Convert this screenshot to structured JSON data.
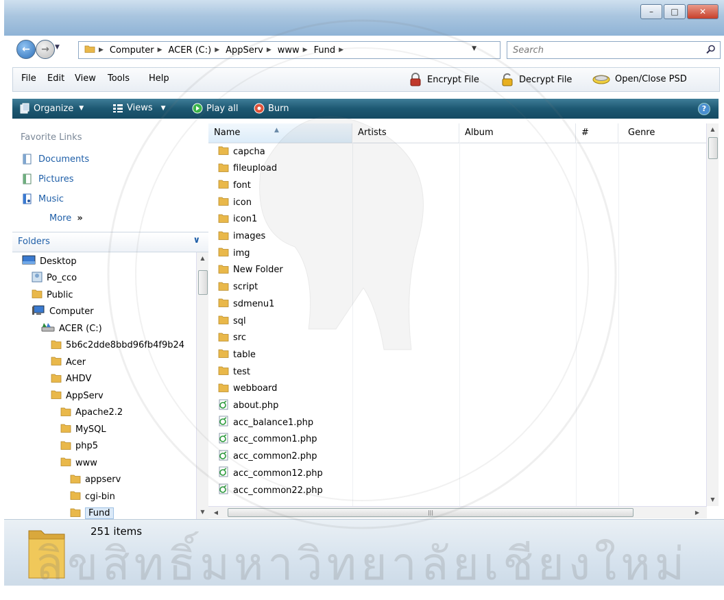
{
  "address": {
    "segments": [
      "Computer",
      "ACER (C:)",
      "AppServ",
      "www",
      "Fund"
    ]
  },
  "search": {
    "placeholder": "Search"
  },
  "menubar": {
    "items": [
      "File",
      "Edit",
      "View",
      "Tools",
      "Help"
    ],
    "tools": [
      "Encrypt File",
      "Decrypt File",
      "Open/Close PSD"
    ]
  },
  "commandbar": {
    "organize": "Organize",
    "views": "Views",
    "play_all": "Play all",
    "burn": "Burn"
  },
  "favorites": {
    "title": "Favorite Links",
    "items": [
      "Documents",
      "Pictures",
      "Music"
    ],
    "more": "More",
    "more_glyph": "»"
  },
  "folders": {
    "title": "Folders",
    "tree": [
      {
        "label": "Desktop",
        "icon": "desktop-icon"
      },
      {
        "label": "Po_cco",
        "icon": "user-icon"
      },
      {
        "label": "Public",
        "icon": "folder-icon"
      },
      {
        "label": "Computer",
        "icon": "computer-icon"
      },
      {
        "label": "ACER (C:)",
        "icon": "drive-icon"
      },
      {
        "label": "5b6c2dde8bbd96fb4f9b24",
        "icon": "folder-icon"
      },
      {
        "label": "Acer",
        "icon": "folder-icon"
      },
      {
        "label": "AHDV",
        "icon": "folder-icon"
      },
      {
        "label": "AppServ",
        "icon": "folder-icon"
      },
      {
        "label": "Apache2.2",
        "icon": "folder-icon"
      },
      {
        "label": "MySQL",
        "icon": "folder-icon"
      },
      {
        "label": "php5",
        "icon": "folder-icon"
      },
      {
        "label": "www",
        "icon": "folder-icon"
      },
      {
        "label": "appserv",
        "icon": "folder-icon"
      },
      {
        "label": "cgi-bin",
        "icon": "folder-icon"
      },
      {
        "label": "Fund",
        "icon": "folder-icon",
        "selected": true
      }
    ]
  },
  "columns": [
    "Name",
    "Artists",
    "Album",
    "#",
    "Genre"
  ],
  "files": [
    {
      "name": "capcha",
      "type": "folder"
    },
    {
      "name": "fileupload",
      "type": "folder"
    },
    {
      "name": "font",
      "type": "folder"
    },
    {
      "name": "icon",
      "type": "folder"
    },
    {
      "name": "icon1",
      "type": "folder"
    },
    {
      "name": "images",
      "type": "folder"
    },
    {
      "name": "img",
      "type": "folder"
    },
    {
      "name": "New Folder",
      "type": "folder"
    },
    {
      "name": "script",
      "type": "folder"
    },
    {
      "name": "sdmenu1",
      "type": "folder"
    },
    {
      "name": "sql",
      "type": "folder"
    },
    {
      "name": "src",
      "type": "folder"
    },
    {
      "name": "table",
      "type": "folder"
    },
    {
      "name": "test",
      "type": "folder"
    },
    {
      "name": "webboard",
      "type": "folder"
    },
    {
      "name": "about.php",
      "type": "php"
    },
    {
      "name": "acc_balance1.php",
      "type": "php"
    },
    {
      "name": "acc_common1.php",
      "type": "php"
    },
    {
      "name": "acc_common2.php",
      "type": "php"
    },
    {
      "name": "acc_common12.php",
      "type": "php"
    },
    {
      "name": "acc_common22.php",
      "type": "php"
    }
  ],
  "status": {
    "item_count": "251 items"
  },
  "watermark": {
    "text": "ลิขสิทธิ์มหาวิทยาลัยเชียงใหม่"
  }
}
